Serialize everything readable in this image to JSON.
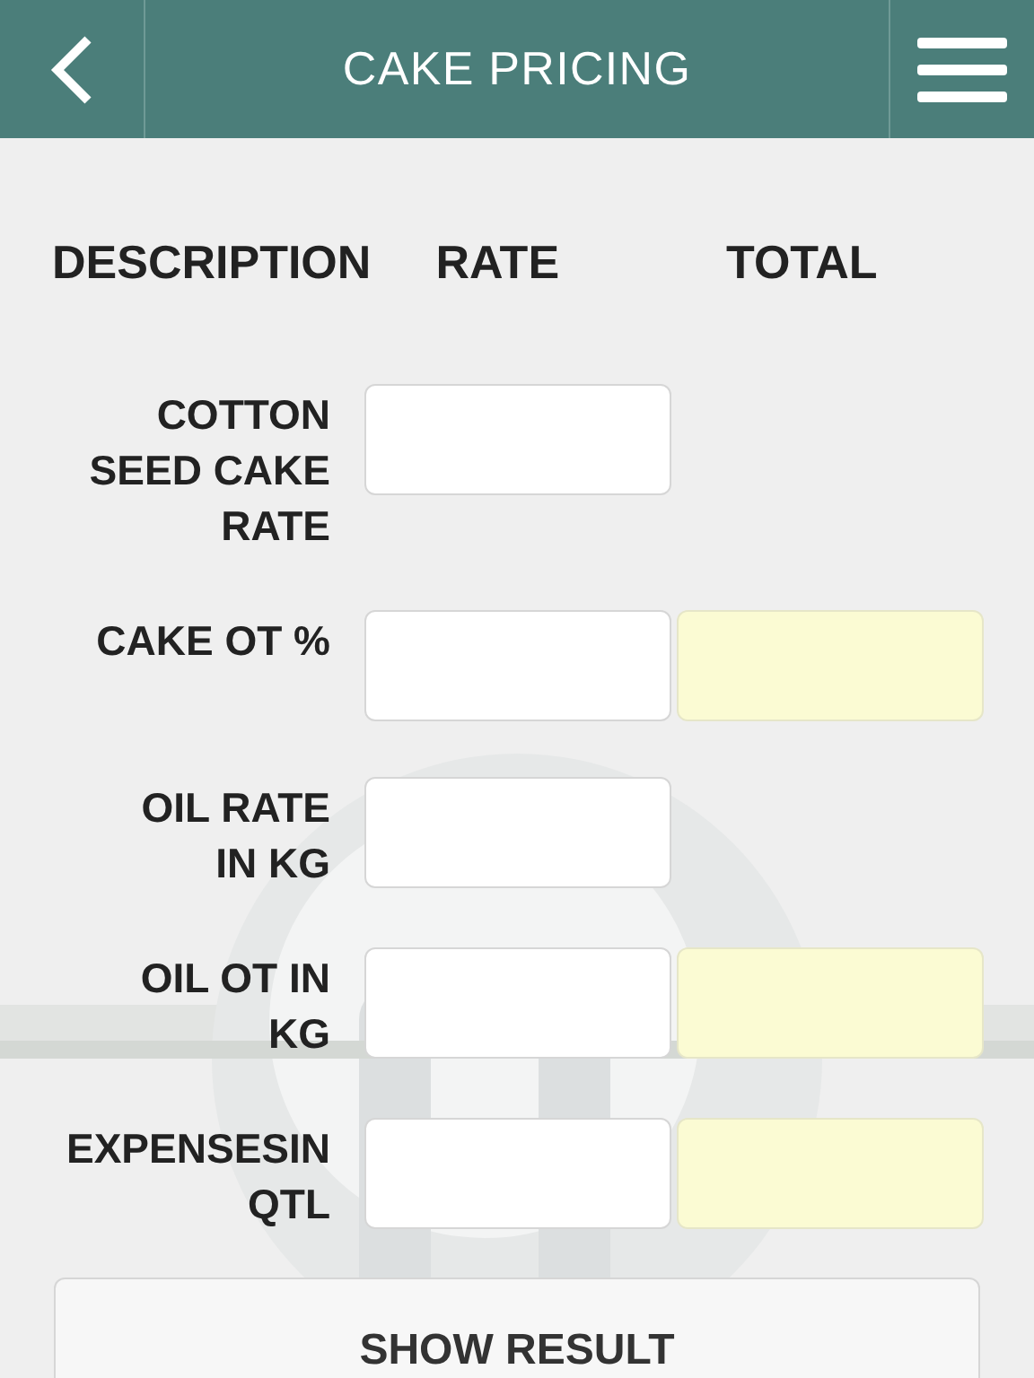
{
  "header": {
    "title": "CAKE PRICING"
  },
  "columns": [
    "DESCRIPTION",
    "RATE",
    "TOTAL"
  ],
  "rows": [
    {
      "label": "COTTON\nSEED CAKE\nRATE",
      "kind": "rate"
    },
    {
      "label": "CAKE OT %",
      "kind": "rate_total"
    },
    {
      "label": "OIL RATE\nIN KG",
      "kind": "rate"
    },
    {
      "label": "OIL OT IN\nKG",
      "kind": "rate_total"
    },
    {
      "label": "EXPENSESIN\nQTL",
      "kind": "rate_total"
    }
  ],
  "button": "SHOW RESULT"
}
